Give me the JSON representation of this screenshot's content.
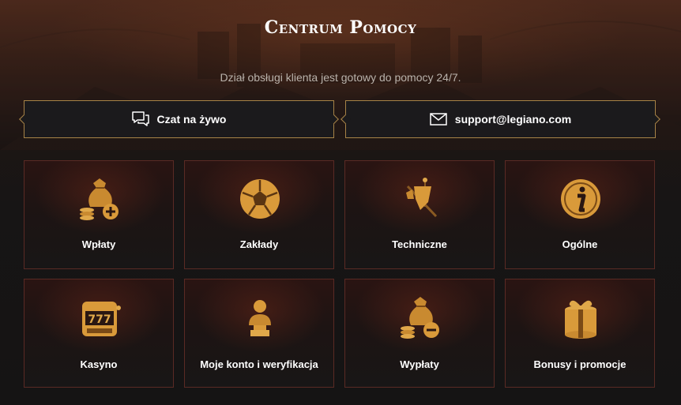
{
  "header": {
    "title": "Centrum Pomocy",
    "subtitle": "Dział obsługi klienta jest gotowy do pomocy 24/7."
  },
  "contacts": {
    "chat_label": "Czat na żywo",
    "chat_icon": "chat-bubbles-icon",
    "email_label": "support@legiano.com",
    "email_icon": "envelope-icon"
  },
  "categories": [
    {
      "label": "Wpłaty",
      "icon": "money-bag-plus-icon"
    },
    {
      "label": "Zakłady",
      "icon": "football-icon"
    },
    {
      "label": "Techniczne",
      "icon": "banner-flag-icon"
    },
    {
      "label": "Ogólne",
      "icon": "info-coin-icon"
    },
    {
      "label": "Kasyno",
      "icon": "slot-machine-icon"
    },
    {
      "label": "Moje konto i weryfikacja",
      "icon": "bust-statue-icon"
    },
    {
      "label": "Wypłaty",
      "icon": "money-bag-minus-icon"
    },
    {
      "label": "Bonusy i promocje",
      "icon": "gift-box-icon"
    }
  ],
  "colors": {
    "accent_gold": "#a78347",
    "icon_gold": "#d99a3a",
    "tile_border": "#5a2a24",
    "background": "#161414"
  }
}
